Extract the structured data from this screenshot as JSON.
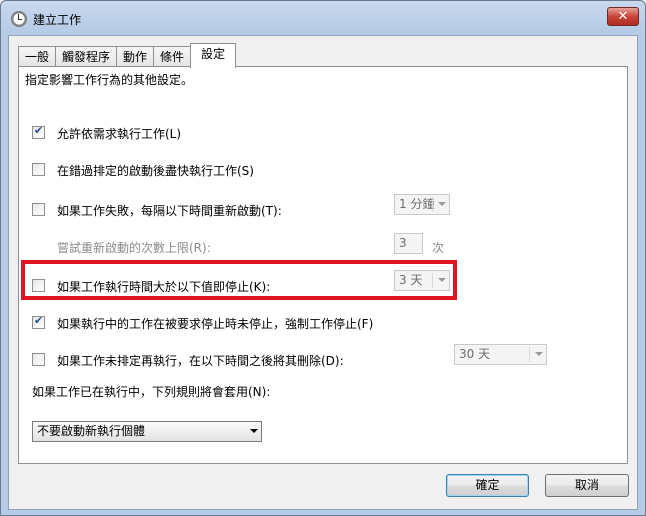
{
  "window": {
    "title": "建立工作",
    "close_glyph": "✕"
  },
  "tabs": [
    {
      "label": "一般"
    },
    {
      "label": "觸發程序"
    },
    {
      "label": "動作"
    },
    {
      "label": "條件"
    },
    {
      "label": "設定"
    }
  ],
  "settings": {
    "description": "指定影響工作行為的其他設定。",
    "allow_on_demand": {
      "label": "允許依需求執行工作(L)",
      "checked": true
    },
    "run_asap": {
      "label": "在錯過排定的啟動後盡快執行工作(S)",
      "checked": false
    },
    "restart_on_fail": {
      "label": "如果工作失敗，每隔以下時間重新啟動(T):",
      "checked": false,
      "value": "1 分鐘"
    },
    "restart_attempts": {
      "label": "嘗試重新啟動的次數上限(R):",
      "value": "3",
      "unit": "次"
    },
    "stop_if_longer": {
      "label": "如果工作執行時間大於以下值即停止(K):",
      "checked": false,
      "value": "3 天"
    },
    "force_stop": {
      "label": "如果執行中的工作在被要求停止時未停止，強制工作停止(F)",
      "checked": true
    },
    "delete_if_not_scheduled": {
      "label": "如果工作未排定再執行，在以下時間之後將其刪除(D):",
      "checked": false,
      "value": "30 天"
    },
    "running_rule": {
      "label": "如果工作已在執行中，下列規則將會套用(N):",
      "value": "不要啟動新執行個體"
    }
  },
  "buttons": {
    "ok": "確定",
    "cancel": "取消"
  },
  "colors": {
    "highlight": "#e0141e",
    "title_bar": "#b6cbe6"
  }
}
